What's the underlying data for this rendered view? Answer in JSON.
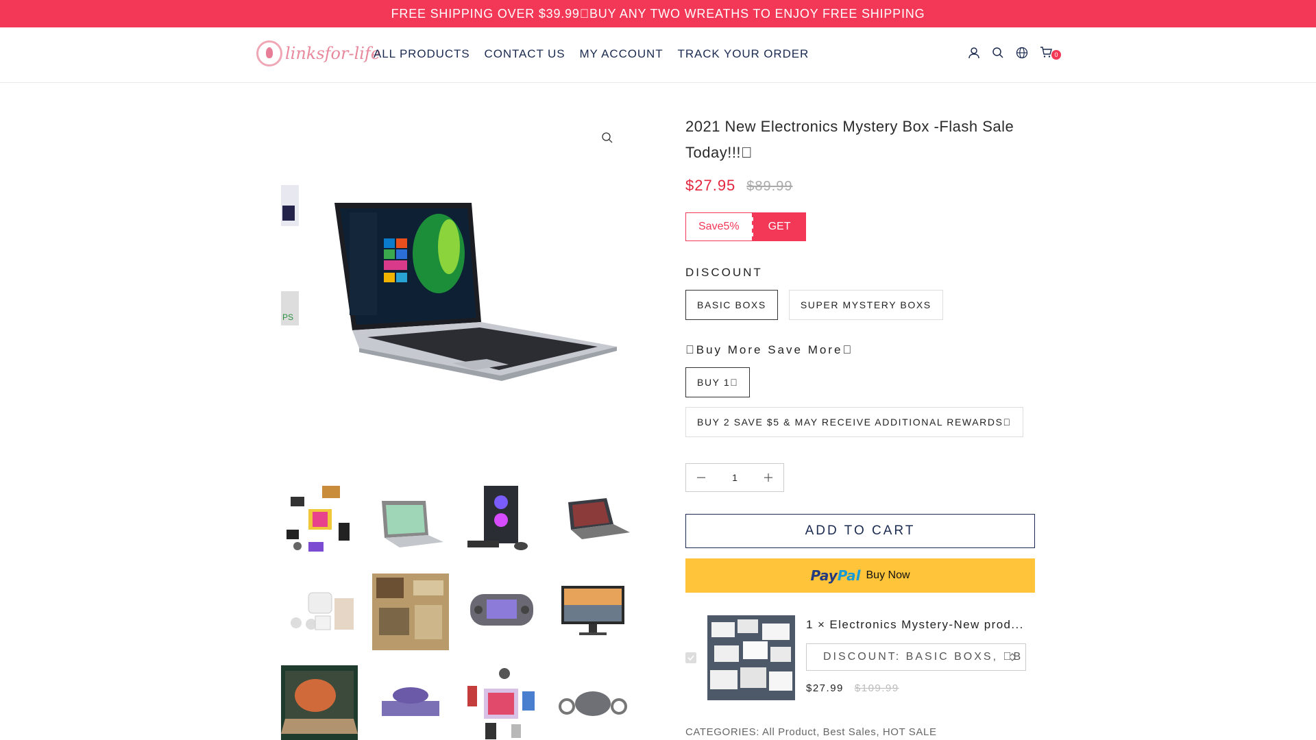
{
  "announcement": "FREE SHIPPING OVER $39.99\u0000BUY ANY TWO WREATHS TO ENJOY FREE SHIPPING",
  "brand": {
    "logo_text": "linksfor-life"
  },
  "nav": [
    "ALL PRODUCTS",
    "CONTACT US",
    "MY ACCOUNT",
    "TRACK YOUR ORDER"
  ],
  "header_icons": [
    "user-icon",
    "search-icon",
    "globe-icon",
    "cart-icon"
  ],
  "cart": {
    "count": "0"
  },
  "product": {
    "title": "2021 New Electronics Mystery Box -Flash Sale Today!!!\u0000",
    "price": "$27.95",
    "compare_price": "$89.99",
    "coupon": {
      "label": "Save5%",
      "action": "GET"
    },
    "options": [
      {
        "label": "DISCOUNT",
        "values": [
          "BASIC BOXS",
          "SUPER MYSTERY BOXS"
        ],
        "selected": "BASIC BOXS"
      },
      {
        "label": "\u0000Buy More Save More\u0000",
        "values": [
          "BUY 1\u0000",
          "BUY 2 SAVE $5 & MAY RECEIVE ADDITIONAL REWARDS\u0000"
        ],
        "selected": "BUY 1\u0000"
      }
    ],
    "quantity": "1",
    "add_to_cart": "ADD TO CART",
    "paypal": {
      "logo_a": "Pay",
      "logo_b": "Pal",
      "label": "Buy Now"
    },
    "bundle": {
      "title": "1 × Electronics Mystery-New prod...",
      "select_value": "DISCOUNT: BASIC BOXS, \u0000B",
      "price": "$27.99",
      "compare_price": "$109.99"
    },
    "categories": "CATEGORIES: All Product, Best Sales, HOT SALE"
  },
  "colors": {
    "accent": "#f33756",
    "nav": "#1a2a4f",
    "paypal": "#ffc439"
  }
}
